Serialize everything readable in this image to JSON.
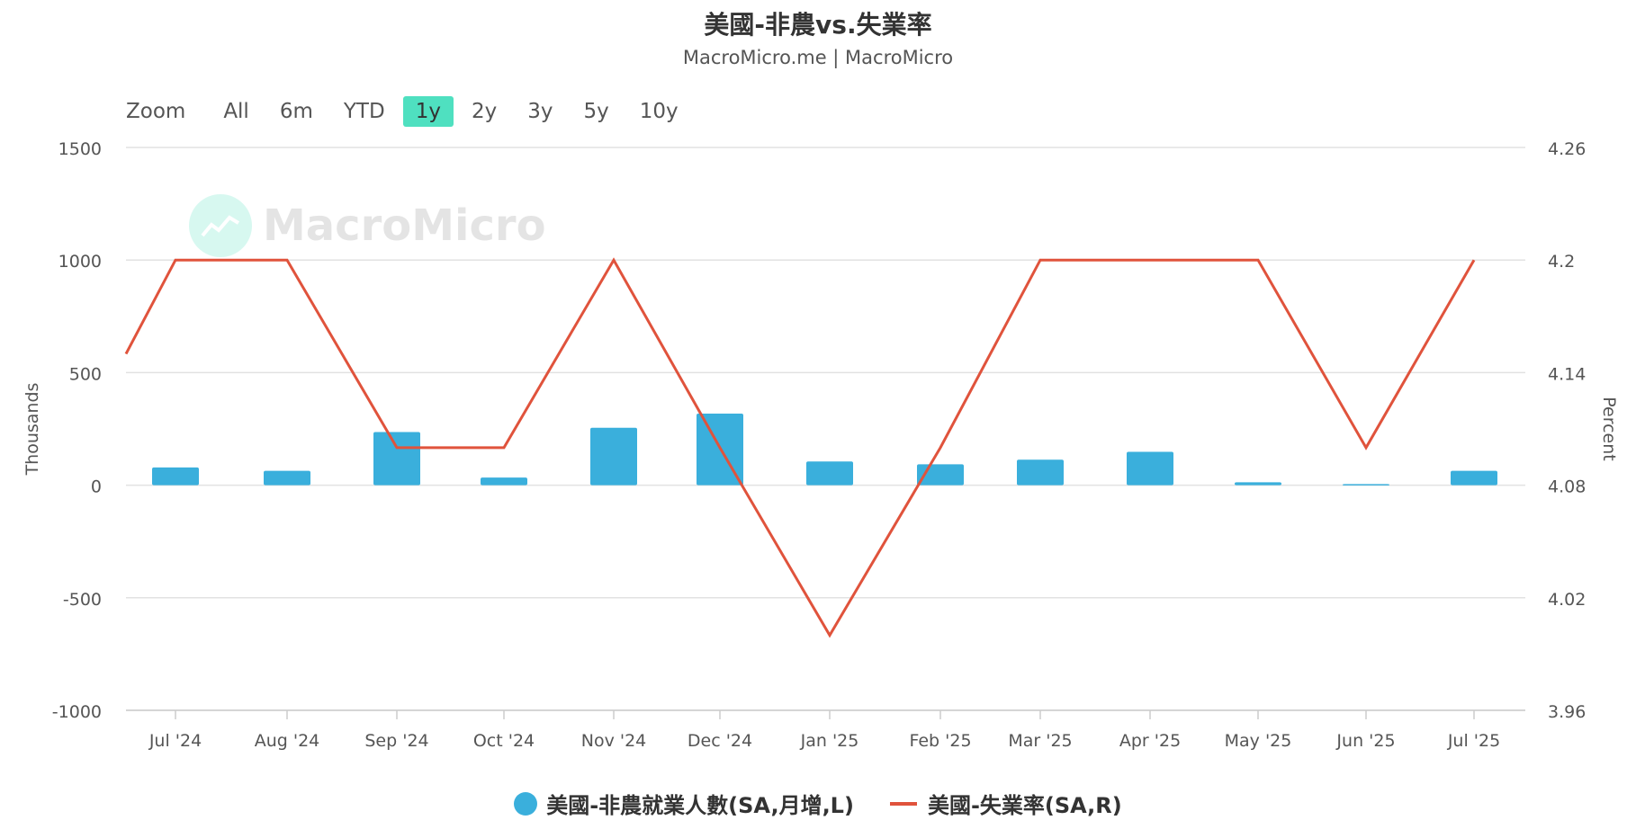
{
  "header": {
    "title": "美國-非農vs.失業率",
    "subtitle": "MacroMicro.me | MacroMicro"
  },
  "zoom": {
    "label": "Zoom",
    "options": [
      "All",
      "6m",
      "YTD",
      "1y",
      "2y",
      "3y",
      "5y",
      "10y"
    ],
    "selected": "1y"
  },
  "watermark": {
    "text": "MacroMicro",
    "icon": "chart-trend-icon"
  },
  "colors": {
    "bar": "#3aafdc",
    "line": "#e0533c",
    "zoom_active": "#4fe0c0"
  },
  "chart_data": {
    "type": "bar+line",
    "categories": [
      "Jul '24",
      "Aug '24",
      "Sep '24",
      "Oct '24",
      "Nov '24",
      "Dec '24",
      "Jan '25",
      "Feb '25",
      "Mar '25",
      "Apr '25",
      "May '25",
      "Jun '25",
      "Jul '25"
    ],
    "series": [
      {
        "name": "美國-非農就業人數(SA,月增,L)",
        "type": "bar",
        "axis": "left",
        "values": [
          79,
          64,
          236,
          34,
          255,
          318,
          105,
          93,
          113,
          148,
          13,
          5,
          64
        ]
      },
      {
        "name": "美國-失業率(SA,R)",
        "type": "line",
        "axis": "right",
        "values": [
          4.2,
          4.2,
          4.1,
          4.1,
          4.2,
          4.1,
          4.0,
          4.1,
          4.2,
          4.2,
          4.2,
          4.1,
          4.2
        ],
        "start_value": 4.15
      }
    ],
    "left_axis": {
      "label": "Thousands",
      "ticks": [
        "1500",
        "1000",
        "500",
        "0",
        "-500",
        "-1000"
      ],
      "ylim": [
        -1000,
        1500
      ]
    },
    "right_axis": {
      "label": "Percent",
      "ticks": [
        "4.26",
        "4.2",
        "4.14",
        "4.08",
        "4.02",
        "3.96"
      ],
      "ylim": [
        3.96,
        4.26
      ]
    },
    "grid": true,
    "legend": "bottom"
  }
}
